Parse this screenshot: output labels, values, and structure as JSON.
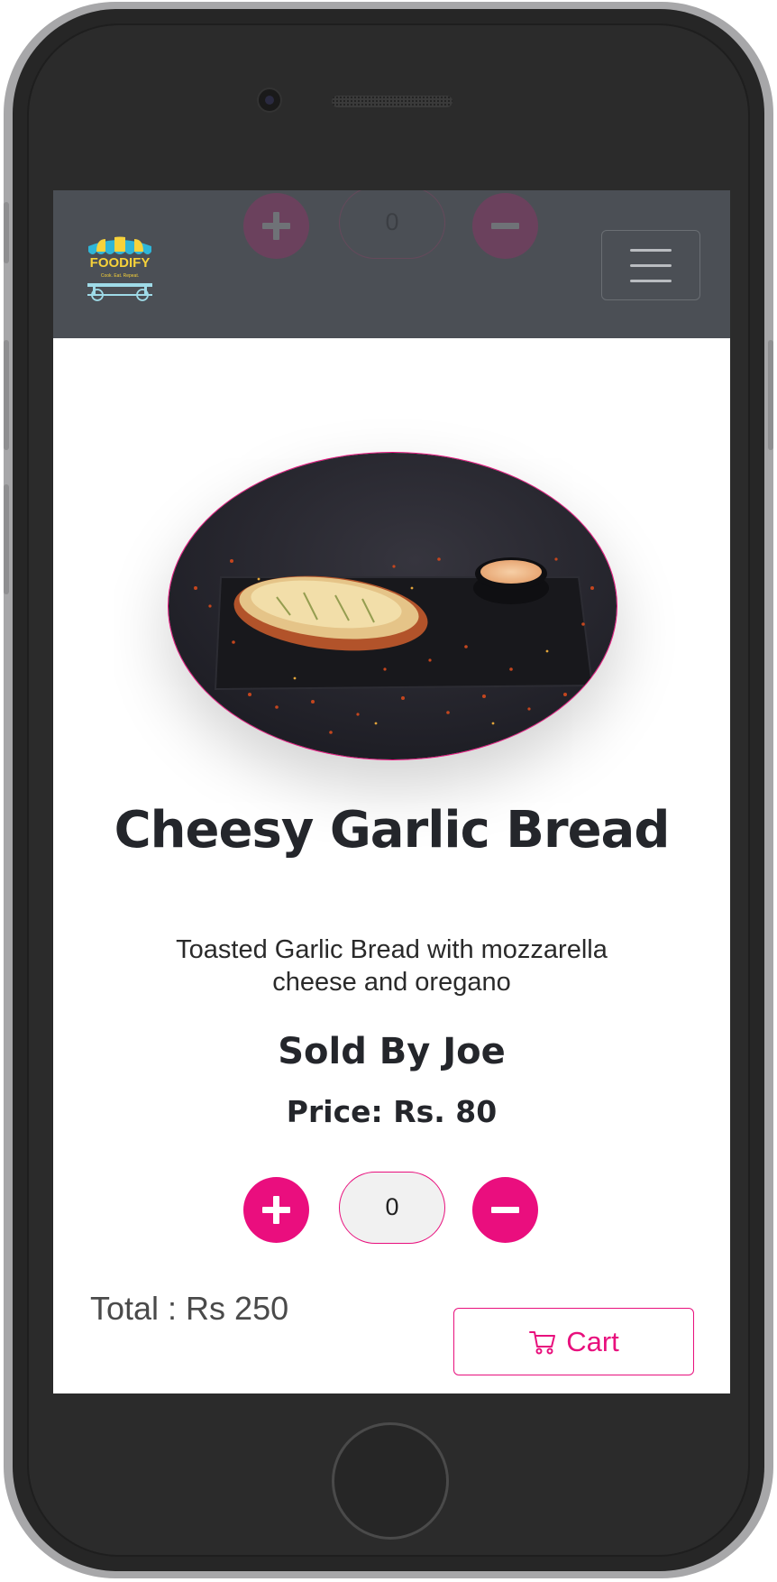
{
  "brand": {
    "name": "FOODIFY",
    "tagline": "Cook. Eat. Repeat."
  },
  "quantity_control": {
    "plus_icon": "plus-icon",
    "minus_icon": "minus-icon",
    "value": "0"
  },
  "product": {
    "title": "Cheesy Garlic Bread",
    "description": "Toasted Garlic Bread with mozzarella cheese and oregano",
    "seller": "Sold By Joe",
    "price": "Price: Rs. 80"
  },
  "footer": {
    "total": "Total : Rs 250",
    "cart_label": "Cart",
    "cart_icon": "cart-icon"
  },
  "colors": {
    "accent": "#e8107d",
    "navbar": "#4b4f55",
    "text": "#24262b"
  }
}
